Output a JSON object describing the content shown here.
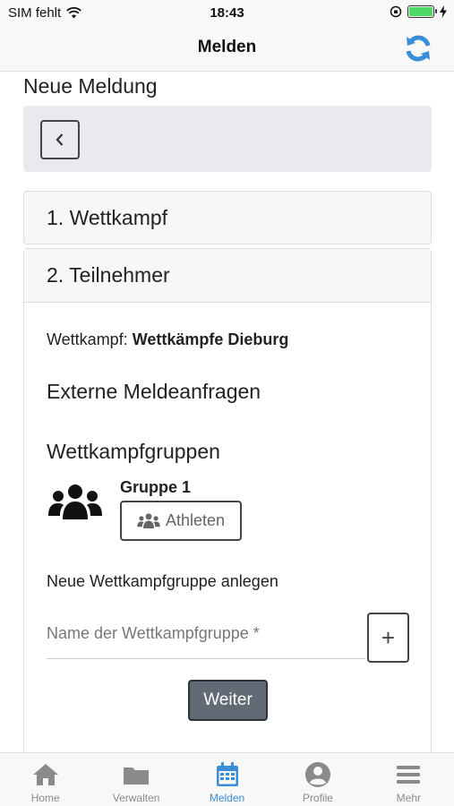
{
  "status": {
    "carrier": "SIM fehlt",
    "time": "18:43"
  },
  "nav": {
    "title": "Melden"
  },
  "page": {
    "title": "Neue Meldung"
  },
  "steps": [
    {
      "label": "1. Wettkampf"
    },
    {
      "label": "2. Teilnehmer"
    }
  ],
  "competition": {
    "label": "Wettkampf:",
    "name": "Wettkämpfe Dieburg"
  },
  "sections": {
    "external": "Externe Meldeanfragen",
    "groups": "Wettkampfgruppen"
  },
  "group": {
    "name": "Gruppe 1",
    "athletes_label": "Athleten"
  },
  "new_group": {
    "label": "Neue Wettkampfgruppe anlegen",
    "placeholder": "Name der Wettkampfgruppe *",
    "value": "",
    "add_label": "+"
  },
  "actions": {
    "next": "Weiter"
  },
  "tabs": [
    {
      "label": "Home",
      "icon": "home-icon"
    },
    {
      "label": "Verwalten",
      "icon": "folder-icon"
    },
    {
      "label": "Melden",
      "icon": "calendar-icon",
      "active": true
    },
    {
      "label": "Profile",
      "icon": "user-icon"
    },
    {
      "label": "Mehr",
      "icon": "menu-icon"
    }
  ],
  "colors": {
    "accent": "#3a8dd6",
    "tab_inactive": "#8a8a8a",
    "primary_button": "#616a75",
    "battery": "#4cd964"
  }
}
